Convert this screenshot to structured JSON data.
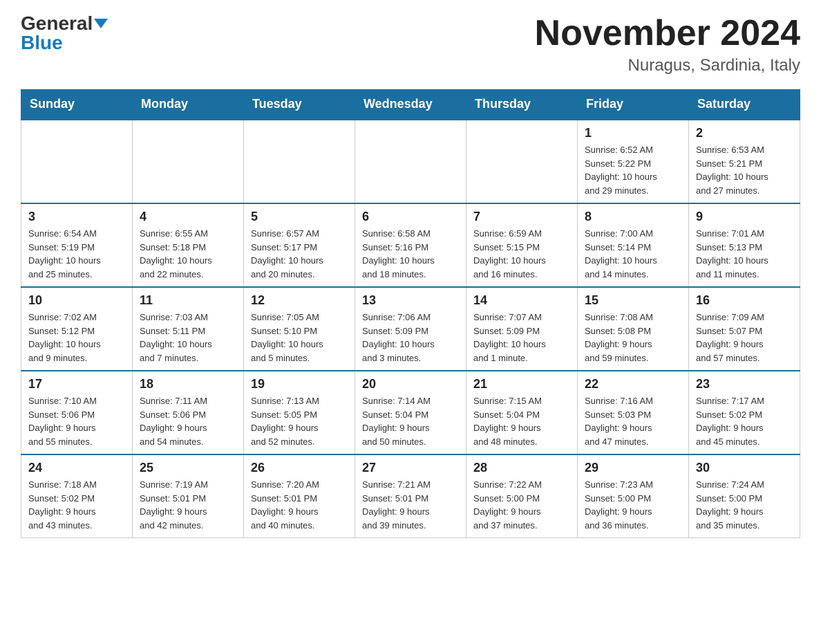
{
  "logo": {
    "general": "General",
    "blue": "Blue"
  },
  "header": {
    "month": "November 2024",
    "location": "Nuragus, Sardinia, Italy"
  },
  "days_of_week": [
    "Sunday",
    "Monday",
    "Tuesday",
    "Wednesday",
    "Thursday",
    "Friday",
    "Saturday"
  ],
  "weeks": [
    [
      {
        "day": "",
        "info": ""
      },
      {
        "day": "",
        "info": ""
      },
      {
        "day": "",
        "info": ""
      },
      {
        "day": "",
        "info": ""
      },
      {
        "day": "",
        "info": ""
      },
      {
        "day": "1",
        "info": "Sunrise: 6:52 AM\nSunset: 5:22 PM\nDaylight: 10 hours\nand 29 minutes."
      },
      {
        "day": "2",
        "info": "Sunrise: 6:53 AM\nSunset: 5:21 PM\nDaylight: 10 hours\nand 27 minutes."
      }
    ],
    [
      {
        "day": "3",
        "info": "Sunrise: 6:54 AM\nSunset: 5:19 PM\nDaylight: 10 hours\nand 25 minutes."
      },
      {
        "day": "4",
        "info": "Sunrise: 6:55 AM\nSunset: 5:18 PM\nDaylight: 10 hours\nand 22 minutes."
      },
      {
        "day": "5",
        "info": "Sunrise: 6:57 AM\nSunset: 5:17 PM\nDaylight: 10 hours\nand 20 minutes."
      },
      {
        "day": "6",
        "info": "Sunrise: 6:58 AM\nSunset: 5:16 PM\nDaylight: 10 hours\nand 18 minutes."
      },
      {
        "day": "7",
        "info": "Sunrise: 6:59 AM\nSunset: 5:15 PM\nDaylight: 10 hours\nand 16 minutes."
      },
      {
        "day": "8",
        "info": "Sunrise: 7:00 AM\nSunset: 5:14 PM\nDaylight: 10 hours\nand 14 minutes."
      },
      {
        "day": "9",
        "info": "Sunrise: 7:01 AM\nSunset: 5:13 PM\nDaylight: 10 hours\nand 11 minutes."
      }
    ],
    [
      {
        "day": "10",
        "info": "Sunrise: 7:02 AM\nSunset: 5:12 PM\nDaylight: 10 hours\nand 9 minutes."
      },
      {
        "day": "11",
        "info": "Sunrise: 7:03 AM\nSunset: 5:11 PM\nDaylight: 10 hours\nand 7 minutes."
      },
      {
        "day": "12",
        "info": "Sunrise: 7:05 AM\nSunset: 5:10 PM\nDaylight: 10 hours\nand 5 minutes."
      },
      {
        "day": "13",
        "info": "Sunrise: 7:06 AM\nSunset: 5:09 PM\nDaylight: 10 hours\nand 3 minutes."
      },
      {
        "day": "14",
        "info": "Sunrise: 7:07 AM\nSunset: 5:09 PM\nDaylight: 10 hours\nand 1 minute."
      },
      {
        "day": "15",
        "info": "Sunrise: 7:08 AM\nSunset: 5:08 PM\nDaylight: 9 hours\nand 59 minutes."
      },
      {
        "day": "16",
        "info": "Sunrise: 7:09 AM\nSunset: 5:07 PM\nDaylight: 9 hours\nand 57 minutes."
      }
    ],
    [
      {
        "day": "17",
        "info": "Sunrise: 7:10 AM\nSunset: 5:06 PM\nDaylight: 9 hours\nand 55 minutes."
      },
      {
        "day": "18",
        "info": "Sunrise: 7:11 AM\nSunset: 5:06 PM\nDaylight: 9 hours\nand 54 minutes."
      },
      {
        "day": "19",
        "info": "Sunrise: 7:13 AM\nSunset: 5:05 PM\nDaylight: 9 hours\nand 52 minutes."
      },
      {
        "day": "20",
        "info": "Sunrise: 7:14 AM\nSunset: 5:04 PM\nDaylight: 9 hours\nand 50 minutes."
      },
      {
        "day": "21",
        "info": "Sunrise: 7:15 AM\nSunset: 5:04 PM\nDaylight: 9 hours\nand 48 minutes."
      },
      {
        "day": "22",
        "info": "Sunrise: 7:16 AM\nSunset: 5:03 PM\nDaylight: 9 hours\nand 47 minutes."
      },
      {
        "day": "23",
        "info": "Sunrise: 7:17 AM\nSunset: 5:02 PM\nDaylight: 9 hours\nand 45 minutes."
      }
    ],
    [
      {
        "day": "24",
        "info": "Sunrise: 7:18 AM\nSunset: 5:02 PM\nDaylight: 9 hours\nand 43 minutes."
      },
      {
        "day": "25",
        "info": "Sunrise: 7:19 AM\nSunset: 5:01 PM\nDaylight: 9 hours\nand 42 minutes."
      },
      {
        "day": "26",
        "info": "Sunrise: 7:20 AM\nSunset: 5:01 PM\nDaylight: 9 hours\nand 40 minutes."
      },
      {
        "day": "27",
        "info": "Sunrise: 7:21 AM\nSunset: 5:01 PM\nDaylight: 9 hours\nand 39 minutes."
      },
      {
        "day": "28",
        "info": "Sunrise: 7:22 AM\nSunset: 5:00 PM\nDaylight: 9 hours\nand 37 minutes."
      },
      {
        "day": "29",
        "info": "Sunrise: 7:23 AM\nSunset: 5:00 PM\nDaylight: 9 hours\nand 36 minutes."
      },
      {
        "day": "30",
        "info": "Sunrise: 7:24 AM\nSunset: 5:00 PM\nDaylight: 9 hours\nand 35 minutes."
      }
    ]
  ]
}
